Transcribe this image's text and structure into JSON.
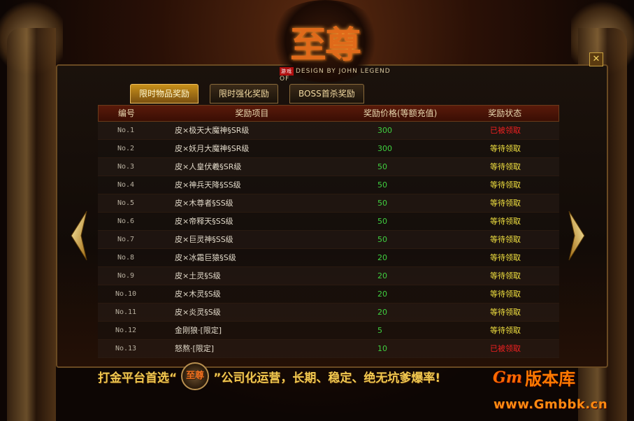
{
  "logo": {
    "title": "至尊",
    "subtitle": "DESIGN BY JOHN LEGEND OF",
    "seal_text": "游戏"
  },
  "close_icon": "✕",
  "tabs": [
    {
      "label": "限时物品奖励",
      "active": true
    },
    {
      "label": "限时强化奖励",
      "active": false
    },
    {
      "label": "BOSS首杀奖励",
      "active": false
    }
  ],
  "table": {
    "headers": [
      "编号",
      "奖励项目",
      "奖励价格(等额充值)",
      "奖励状态"
    ],
    "rows": [
      {
        "no": "No.1",
        "item": "皮×极天大魔神§SR级",
        "price": "300",
        "status": "已被领取",
        "claimed": true
      },
      {
        "no": "No.2",
        "item": "皮×妖月大魔神§SR级",
        "price": "300",
        "status": "等待领取",
        "claimed": false
      },
      {
        "no": "No.3",
        "item": "皮×人皇伏羲§SR级",
        "price": "50",
        "status": "等待领取",
        "claimed": false
      },
      {
        "no": "No.4",
        "item": "皮×神兵天降§SS级",
        "price": "50",
        "status": "等待领取",
        "claimed": false
      },
      {
        "no": "No.5",
        "item": "皮×木尊者§SS级",
        "price": "50",
        "status": "等待领取",
        "claimed": false
      },
      {
        "no": "No.6",
        "item": "皮×帝释天§SS级",
        "price": "50",
        "status": "等待领取",
        "claimed": false
      },
      {
        "no": "No.7",
        "item": "皮×巨灵神§SS级",
        "price": "50",
        "status": "等待领取",
        "claimed": false
      },
      {
        "no": "No.8",
        "item": "皮×冰霜巨猿§S级",
        "price": "20",
        "status": "等待领取",
        "claimed": false
      },
      {
        "no": "No.9",
        "item": "皮×土灵§S级",
        "price": "20",
        "status": "等待领取",
        "claimed": false
      },
      {
        "no": "No.10",
        "item": "皮×木灵§S级",
        "price": "20",
        "status": "等待领取",
        "claimed": false
      },
      {
        "no": "No.11",
        "item": "皮×炎灵§S级",
        "price": "20",
        "status": "等待领取",
        "claimed": false
      },
      {
        "no": "No.12",
        "item": "金刚狼·[限定]",
        "price": "5",
        "status": "等待领取",
        "claimed": false
      },
      {
        "no": "No.13",
        "item": "怒熬·[限定]",
        "price": "10",
        "status": "已被领取",
        "claimed": true
      }
    ]
  },
  "nav": {
    "prev_icon": "arrow-left-icon",
    "next_icon": "arrow-right-icon"
  },
  "footer": {
    "text_before": "打金平台首选“",
    "logo_text": "至尊",
    "text_after": "”公司化运营，长期、稳定、绝无坑爹爆率!"
  },
  "watermark": {
    "logo": "Gm",
    "title": "版本库",
    "url": "www.Gmbbk.cn"
  },
  "colors": {
    "price": "#40d040",
    "status_waiting": "#f0e040",
    "status_claimed": "#f02020",
    "accent_gold": "#f0c850"
  }
}
